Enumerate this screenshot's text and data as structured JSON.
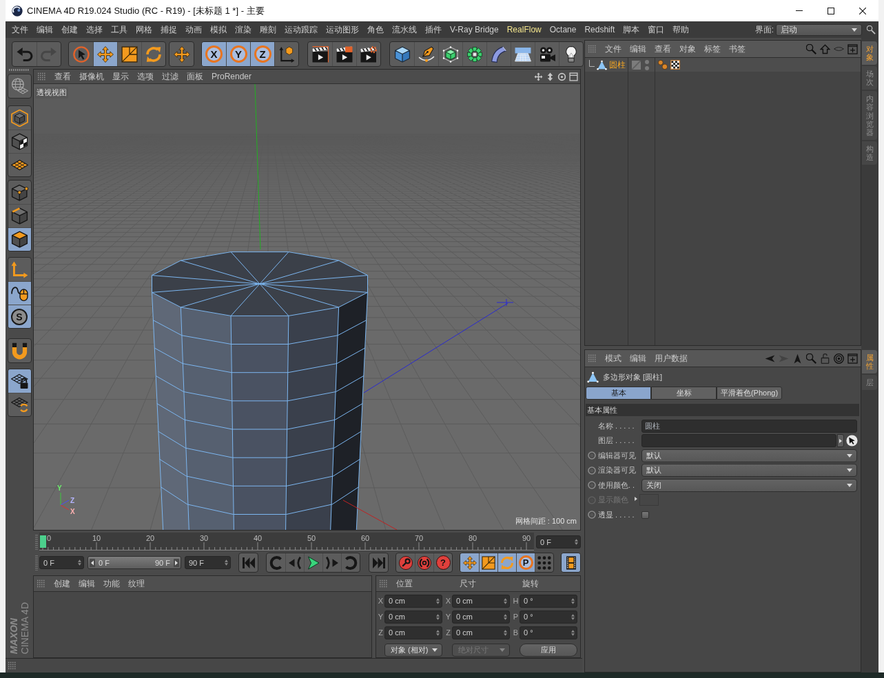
{
  "window": {
    "title": "CINEMA 4D R19.024 Studio (RC - R19) - [未标题 1 *] - 主要"
  },
  "menu_bar": {
    "items": [
      {
        "label": "文件",
        "highlighted": false
      },
      {
        "label": "编辑",
        "highlighted": false
      },
      {
        "label": "创建",
        "highlighted": false
      },
      {
        "label": "选择",
        "highlighted": false
      },
      {
        "label": "工具",
        "highlighted": false
      },
      {
        "label": "网格",
        "highlighted": false
      },
      {
        "label": "捕捉",
        "highlighted": false
      },
      {
        "label": "动画",
        "highlighted": false
      },
      {
        "label": "模拟",
        "highlighted": false
      },
      {
        "label": "渲染",
        "highlighted": false
      },
      {
        "label": "雕刻",
        "highlighted": false
      },
      {
        "label": "运动跟踪",
        "highlighted": false
      },
      {
        "label": "运动图形",
        "highlighted": false
      },
      {
        "label": "角色",
        "highlighted": false
      },
      {
        "label": "流水线",
        "highlighted": false
      },
      {
        "label": "插件",
        "highlighted": false
      },
      {
        "label": "V-Ray Bridge",
        "highlighted": false
      },
      {
        "label": "RealFlow",
        "highlighted": true
      },
      {
        "label": "Octane",
        "highlighted": false
      },
      {
        "label": "Redshift",
        "highlighted": false
      },
      {
        "label": "脚本",
        "highlighted": false
      },
      {
        "label": "窗口",
        "highlighted": false
      },
      {
        "label": "帮助",
        "highlighted": false
      }
    ],
    "layout_label": "界面:",
    "layout_value": "启动"
  },
  "toolbar": {
    "groups": [
      [
        {
          "kind": "undo",
          "on": false,
          "disabled": false
        },
        {
          "kind": "redo",
          "on": false,
          "disabled": true
        }
      ],
      [
        {
          "kind": "live-select",
          "on": false
        },
        {
          "kind": "move",
          "on": true
        },
        {
          "kind": "scale",
          "on": false
        },
        {
          "kind": "rotate",
          "on": false
        }
      ],
      [
        {
          "kind": "transform",
          "on": false
        }
      ],
      [
        {
          "kind": "x-axis",
          "label": "X",
          "on": true
        },
        {
          "kind": "y-axis",
          "label": "Y",
          "on": true
        },
        {
          "kind": "z-axis",
          "label": "Z",
          "on": true
        },
        {
          "kind": "coordinate-system",
          "on": false
        }
      ],
      [
        {
          "kind": "render-view",
          "on": false
        },
        {
          "kind": "render-picture",
          "on": false
        },
        {
          "kind": "render-settings",
          "on": false
        }
      ],
      [
        {
          "kind": "cube",
          "on": false
        },
        {
          "kind": "pen",
          "on": false
        },
        {
          "kind": "subdivision",
          "on": false
        },
        {
          "kind": "cloner",
          "on": false
        },
        {
          "kind": "bend",
          "on": false
        },
        {
          "kind": "floor",
          "on": false
        },
        {
          "kind": "camera",
          "on": false
        },
        {
          "kind": "light",
          "on": false
        }
      ]
    ]
  },
  "left_toolbar": {
    "groups": [
      [
        {
          "kind": "make-editable",
          "on": false
        }
      ],
      [
        {
          "kind": "model-mode",
          "on": false
        },
        {
          "kind": "texture-mode",
          "on": false
        },
        {
          "kind": "workplane-mode",
          "on": false
        }
      ],
      [
        {
          "kind": "points-mode",
          "on": false
        },
        {
          "kind": "edges-mode",
          "on": false
        },
        {
          "kind": "polygons-mode",
          "on": true
        }
      ],
      [
        {
          "kind": "axis-mode",
          "on": false
        },
        {
          "kind": "tweak-mode",
          "on": true
        },
        {
          "kind": "solo",
          "label": "S",
          "on": true
        }
      ],
      [
        {
          "kind": "snap",
          "on": false
        }
      ],
      [
        {
          "kind": "lock-workplane",
          "on": true
        },
        {
          "kind": "align-workplane",
          "on": false
        }
      ]
    ]
  },
  "viewport": {
    "menu": [
      "查看",
      "摄像机",
      "显示",
      "选项",
      "过滤",
      "面板",
      "ProRender"
    ],
    "view_name": "透视视图",
    "grid_spacing": "网格间距 : 100 cm",
    "axis_labels": [
      "Y",
      "Z",
      "X"
    ]
  },
  "timeline": {
    "ticks": [
      "0",
      "10",
      "20",
      "30",
      "40",
      "50",
      "60",
      "70",
      "80",
      "90"
    ],
    "playhead": {
      "level": 0
    },
    "current_frame": "0 F"
  },
  "transport": {
    "start_frame": "0 F",
    "range": {
      "start": "0 F",
      "end": "90 F",
      "level": 1
    },
    "end_frame": "90 F",
    "groups": [
      [
        {
          "kind": "first-frame",
          "on": false
        }
      ],
      [
        {
          "kind": "prev-key",
          "on": false
        },
        {
          "kind": "prev-frame",
          "on": false
        },
        {
          "kind": "play",
          "on": false
        },
        {
          "kind": "next-frame",
          "on": false
        },
        {
          "kind": "next-key",
          "on": false
        }
      ],
      [
        {
          "kind": "last-frame",
          "on": false
        }
      ],
      [
        {
          "kind": "record",
          "on": false
        },
        {
          "kind": "autokey",
          "on": false
        },
        {
          "kind": "keyframe-selection",
          "label": "?",
          "on": false
        }
      ],
      [
        {
          "kind": "key-position",
          "on": true
        },
        {
          "kind": "key-scale",
          "on": true
        },
        {
          "kind": "key-rotation",
          "on": true
        },
        {
          "kind": "key-parameter",
          "label": "P",
          "on": true
        },
        {
          "kind": "key-point-level",
          "on": false
        }
      ],
      [
        {
          "kind": "timeline",
          "on": true
        }
      ]
    ]
  },
  "material_manager": {
    "menu": [
      "创建",
      "编辑",
      "功能",
      "纹理"
    ]
  },
  "coordinates": {
    "headers": [
      "位置",
      "尺寸",
      "旋转"
    ],
    "rows": [
      {
        "position_axis": "X",
        "position": "0 cm",
        "size_axis": "X",
        "size": "0 cm",
        "rotation_axis": "H",
        "rotation": "0 °"
      },
      {
        "position_axis": "Y",
        "position": "0 cm",
        "size_axis": "Y",
        "size": "0 cm",
        "rotation_axis": "P",
        "rotation": "0 °"
      },
      {
        "position_axis": "Z",
        "position": "0 cm",
        "size_axis": "Z",
        "size": "0 cm",
        "rotation_axis": "B",
        "rotation": "0 °"
      }
    ],
    "mode": "对象 (相对)",
    "size_mode": {
      "label": "绝对尺寸",
      "disabled": true
    },
    "apply": "应用"
  },
  "logo": {
    "brand": "MAXON",
    "product": "CINEMA 4D"
  },
  "object_manager": {
    "menu": [
      "文件",
      "编辑",
      "查看",
      "对象",
      "标签",
      "书签"
    ],
    "objects": [
      {
        "name": "圆柱",
        "selected": true,
        "tags": [
          {
            "kind": "phong"
          },
          {
            "kind": "texture"
          }
        ]
      }
    ]
  },
  "side_tabs": {
    "upper": [
      {
        "label": "对象",
        "selected": true
      },
      {
        "label": "场次",
        "selected": false
      },
      {
        "label": "内容浏览器",
        "selected": false
      },
      {
        "label": "构造",
        "selected": false
      }
    ],
    "lower": [
      {
        "label": "属性",
        "selected": true
      },
      {
        "label": "层",
        "selected": false
      }
    ]
  },
  "attributes": {
    "menu": [
      "模式",
      "编辑",
      "用户数据"
    ],
    "navigation": [
      {
        "kind": "back",
        "disabled": false
      },
      {
        "kind": "forward",
        "disabled": true
      },
      {
        "kind": "up",
        "disabled": false
      }
    ],
    "object_title": "多边形对象 [圆柱]",
    "tabs": [
      {
        "label": "基本",
        "selected": true
      },
      {
        "label": "坐标",
        "selected": false
      },
      {
        "label": "平滑着色(Phong)",
        "selected": false
      }
    ],
    "section": "基本属性",
    "fields": [
      {
        "kind": "text",
        "label": "名称 . . . . .",
        "value": "圆柱",
        "disabled": false
      },
      {
        "kind": "link",
        "label": "图层 . . . . .",
        "disabled": false
      },
      {
        "kind": "dropdown",
        "label": "编辑器可见",
        "value": "默认",
        "disabled": false
      },
      {
        "kind": "dropdown",
        "label": "渲染器可见",
        "value": "默认",
        "disabled": false
      },
      {
        "kind": "dropdown",
        "label": "使用颜色. .",
        "value": "关闭",
        "disabled": false
      },
      {
        "kind": "color",
        "label": "显示颜色",
        "disabled": true
      },
      {
        "kind": "checkbox",
        "label": "透显 . . . . .",
        "checked": false,
        "disabled": false
      }
    ]
  }
}
